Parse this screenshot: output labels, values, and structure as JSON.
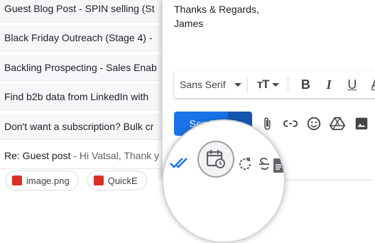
{
  "inbox": {
    "rows": [
      {
        "subject": "Guest Blog Post - SPIN selling (St",
        "snippet": ""
      },
      {
        "subject": "Black Friday Outreach (Stage 4) -",
        "snippet": ""
      },
      {
        "subject": "Backling Prospecting - Sales Enab",
        "snippet": ""
      },
      {
        "subject": "Find b2b data from LinkedIn with",
        "snippet": ""
      },
      {
        "subject": "Don't want a subscription? Bulk cr",
        "snippet": ""
      },
      {
        "subject": "Re: Guest post",
        "snippet": " - Hi Vatsal, Thank y"
      }
    ],
    "attachments": [
      {
        "name": "image.png"
      },
      {
        "name": "QuickE"
      }
    ]
  },
  "compose": {
    "signature": [
      "Thanks & Regards,",
      "James"
    ],
    "format_toolbar": {
      "font": "Sans Serif",
      "bold": "B",
      "italic": "I",
      "underline": "U",
      "text_color": "A"
    },
    "send_label": "Send"
  },
  "colors": {
    "send_blue": "#1a73e8",
    "attachment_red": "#d93025",
    "checkmark_blue": "#1a73e8"
  }
}
